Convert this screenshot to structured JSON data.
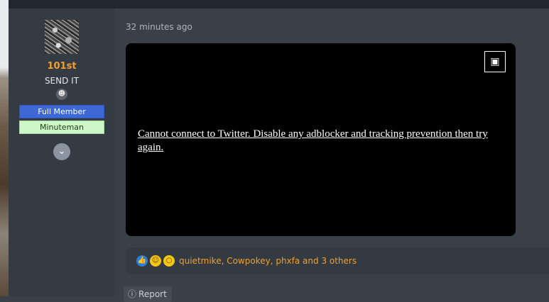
{
  "user": {
    "username": "101st",
    "title": "SEND IT",
    "banners": [
      "Full Member",
      "Minuteman"
    ]
  },
  "post": {
    "time": "32 minutes ago",
    "embed_message": "Cannot connect to Twitter. Disable any adblocker and tracking prevention then try again."
  },
  "reactions": {
    "icons": [
      "like-icon",
      "laugh-icon",
      "wow-icon"
    ],
    "users_text": "quietmike, Cowpokey, phxfa and 3 others"
  },
  "actions": {
    "report_label": "Report"
  },
  "colors": {
    "username": "#f0a030",
    "full_member_banner": "#3e68d6",
    "minuteman_banner": "#cdf7c7",
    "embed_bg": "#000000"
  }
}
